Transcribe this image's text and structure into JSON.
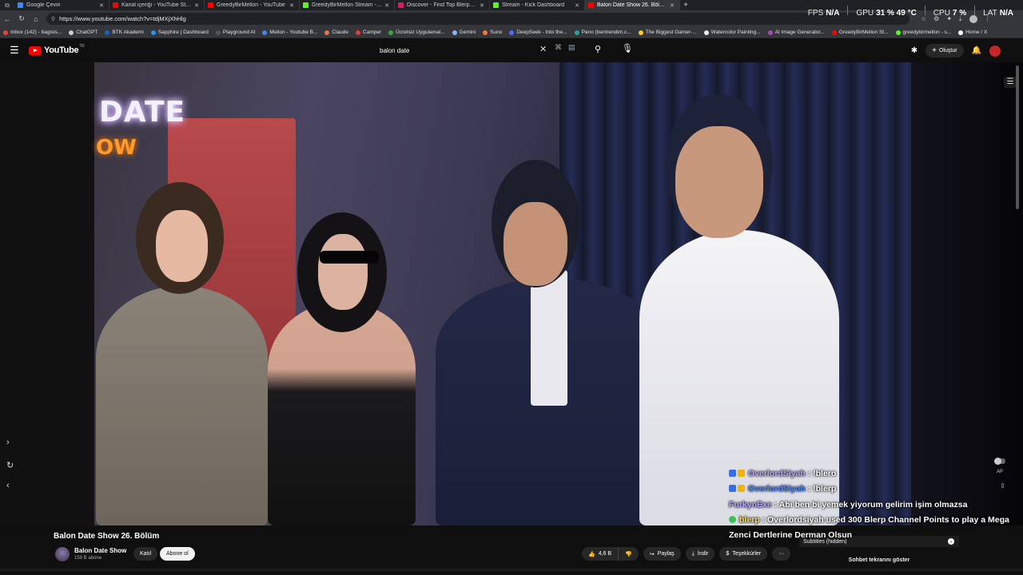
{
  "browser": {
    "tabs": [
      {
        "label": "Google Çeviri",
        "color": "#4285f4",
        "active": false
      },
      {
        "label": "Kanal içeriği - YouTube Studio",
        "color": "#ff0000",
        "active": false
      },
      {
        "label": "GreedyBirMellon - YouTube",
        "color": "#ff0000",
        "active": false
      },
      {
        "label": "GreedyBirMellon Stream - Watch",
        "color": "#53fc18",
        "active": false
      },
      {
        "label": "Discover - Find Top Blerps, Stream",
        "color": "#d02060",
        "active": false
      },
      {
        "label": "Stream - Kick Dashboard",
        "color": "#53fc18",
        "active": false
      },
      {
        "label": "Balon Date Show 26. Bölüm - You",
        "color": "#ff0000",
        "active": true
      }
    ],
    "url": "https://www.youtube.com/watch?v=tdjMXjXhHlg",
    "bookmarks": [
      {
        "label": "Inbox (142) - bagisis...",
        "color": "#ea4335"
      },
      {
        "label": "ChatGPT",
        "color": "#cccccc"
      },
      {
        "label": "BTK Akademi",
        "color": "#1565c0"
      },
      {
        "label": "Sapphire | Dashboard",
        "color": "#2196f3"
      },
      {
        "label": "Playground AI",
        "color": "#555555"
      },
      {
        "label": "Mellon - Youtube B...",
        "color": "#4285f4"
      },
      {
        "label": "Claude",
        "color": "#d97757"
      },
      {
        "label": "Camper",
        "color": "#e53935"
      },
      {
        "label": "Ücretsiz Uygulamal...",
        "color": "#43a047"
      },
      {
        "label": "Gemini",
        "color": "#8ab4f8"
      },
      {
        "label": "Suno",
        "color": "#ff7043"
      },
      {
        "label": "DeepSeek - Into the...",
        "color": "#4d6bfe"
      },
      {
        "label": "Pano (bentrendim.c...",
        "color": "#26a69a"
      },
      {
        "label": "The Biggest Gamer-...",
        "color": "#ffca28"
      },
      {
        "label": "Watercolor Painting...",
        "color": "#eeeeee"
      },
      {
        "label": "AI Image Generator...",
        "color": "#ab47bc"
      },
      {
        "label": "GreedyBirMellon St...",
        "color": "#ff0000"
      },
      {
        "label": "greedybirmellon - s...",
        "color": "#53fc18"
      },
      {
        "label": "Home / X",
        "color": "#ffffff"
      }
    ]
  },
  "stats": {
    "fps_label": "FPS",
    "fps_value": "N/A",
    "gpu_label": "GPU",
    "gpu_value": "31 % 49 °C",
    "cpu_label": "CPU",
    "cpu_value": "7 %",
    "lat_label": "LAT",
    "lat_value": "N/A"
  },
  "youtube": {
    "logo_text": "YouTube",
    "logo_region": "TR",
    "search_value": "balon date",
    "create_label": "Oluştur"
  },
  "video": {
    "neon_line1": "DATE",
    "neon_line2": "OW",
    "autoplay_label": "AP"
  },
  "chat": [
    {
      "user": "OverlordSiyah",
      "sep": " : ",
      "text": "!blero",
      "style": "user-purple",
      "badges": "sq-crown"
    },
    {
      "user": "OverlordSiyah",
      "sep": " : ",
      "text": "!blerp",
      "style": "user-blue",
      "badges": "sq-crown"
    },
    {
      "user": "FurkynExe",
      "sep": " : ",
      "text": "Abi ben bi yemek yiyorum gelirim işim olmazsa",
      "style": "user-purple",
      "badges": ""
    },
    {
      "user": "blerp",
      "sep": " : ",
      "text": "Overlordsiyah used 300 Blerp Channel Points to play a Mega Zenci Dertlerine Derman Olsun",
      "style": "user-yellow",
      "badges": "check"
    }
  ],
  "below": {
    "title": "Balon Date Show 26. Bölüm",
    "channel_name": "Balon Date Show",
    "channel_subs": "159 B abone",
    "join_label": "Katıl",
    "subscribe_label": "Abone ol",
    "like_count": "4,6 B",
    "share_label": "Paylaş",
    "download_label": "İndir",
    "thanks_label": "Teşekkürler",
    "more_label": "···",
    "subtitles_label": "Subtitles (hidden)",
    "show_chat_label": "Sohbet tekrarını göster"
  }
}
